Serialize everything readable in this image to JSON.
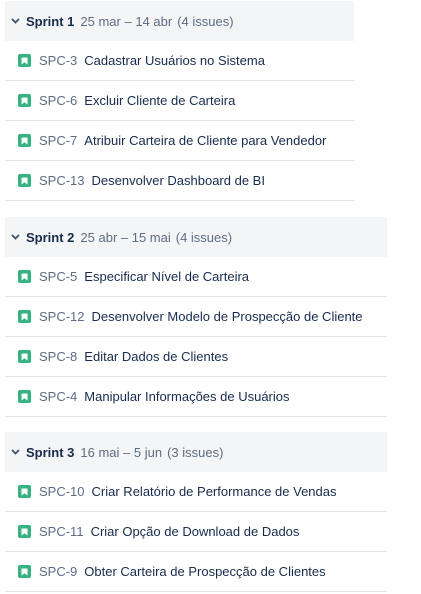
{
  "sprints": [
    {
      "name": "Sprint 1",
      "dates": "25 mar – 14 abr",
      "count": "(4 issues)",
      "issues": [
        {
          "key": "SPC-3",
          "summary": "Cadastrar Usuários no Sistema"
        },
        {
          "key": "SPC-6",
          "summary": "Excluir Cliente de Carteira"
        },
        {
          "key": "SPC-7",
          "summary": "Atribuir Carteira de Cliente para Vendedor"
        },
        {
          "key": "SPC-13",
          "summary": "Desenvolver Dashboard de BI"
        }
      ]
    },
    {
      "name": "Sprint 2",
      "dates": "25 abr – 15 mai",
      "count": "(4 issues)",
      "issues": [
        {
          "key": "SPC-5",
          "summary": "Especificar Nível de Carteira"
        },
        {
          "key": "SPC-12",
          "summary": "Desenvolver Modelo de Prospecção de Cliente"
        },
        {
          "key": "SPC-8",
          "summary": "Editar Dados de Clientes"
        },
        {
          "key": "SPC-4",
          "summary": "Manipular Informações de Usuários"
        }
      ]
    },
    {
      "name": "Sprint 3",
      "dates": "16 mai – 5 jun",
      "count": "(3 issues)",
      "issues": [
        {
          "key": "SPC-10",
          "summary": "Criar Relatório de Performance de Vendas"
        },
        {
          "key": "SPC-11",
          "summary": "Criar Opção de Download de Dados"
        },
        {
          "key": "SPC-9",
          "summary": "Obter Carteira de Prospecção de Clientes"
        }
      ]
    }
  ],
  "icons": {
    "toggle": "chevron-down-icon",
    "issue_type": "story-icon"
  },
  "colors": {
    "story": "#36b37e",
    "header_bg": "#f4f5f7"
  }
}
